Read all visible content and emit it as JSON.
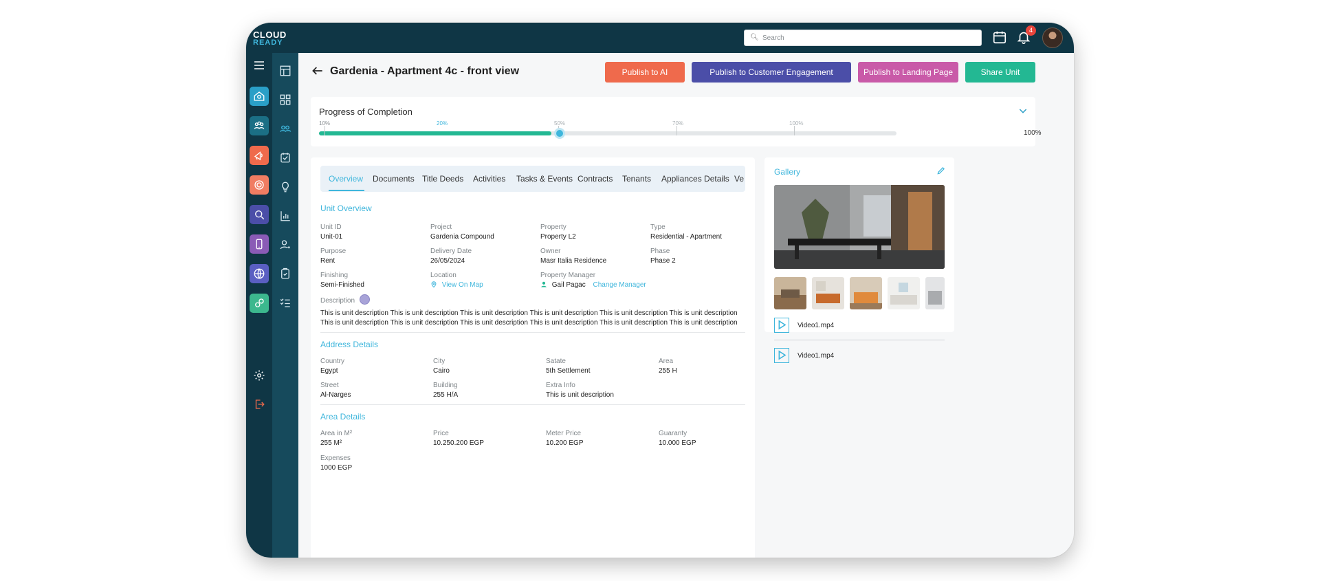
{
  "app": {
    "logo_line1": "CLOUD",
    "logo_line2": "READY"
  },
  "topbar": {
    "search_placeholder": "Search",
    "notification_count": "4"
  },
  "header": {
    "title": "Gardenia - Apartment 4c - front view",
    "buttons": [
      {
        "label": "Publish to AI",
        "color": "#ef6a4c"
      },
      {
        "label": "Publish to Customer Engagement",
        "color": "#4b4ea8"
      },
      {
        "label": "Publish to Landing Page",
        "color": "#c95aa8"
      },
      {
        "label": "Share Unit",
        "color": "#23b893"
      }
    ]
  },
  "progress": {
    "title": "Progress of Completion",
    "ticks": [
      "10%",
      "20%",
      "50%",
      "70%",
      "100%"
    ],
    "current": 20,
    "end_label": "100%"
  },
  "tabs": [
    "Overview",
    "Documents",
    "Title Deeds",
    "Activities",
    "Tasks & Events",
    "Contracts",
    "Tenants",
    "Appliances Details",
    "Ve"
  ],
  "unit_overview": {
    "title": "Unit Overview",
    "fields": [
      {
        "label": "Unit ID",
        "value": "Unit-01"
      },
      {
        "label": "Project",
        "value": "Gardenia Compound"
      },
      {
        "label": "Property",
        "value": "Property L2"
      },
      {
        "label": "Type",
        "value": "Residential - Apartment"
      },
      {
        "label": "Purpose",
        "value": "Rent"
      },
      {
        "label": "Delivery Date",
        "value": "26/05/2024"
      },
      {
        "label": "Owner",
        "value": "Masr Italia Residence"
      },
      {
        "label": "Phase",
        "value": "Phase 2"
      },
      {
        "label": "Finishing",
        "value": "Semi-Finished"
      }
    ],
    "location": {
      "label": "Location",
      "link": "View On Map"
    },
    "manager": {
      "label": "Property Manager",
      "name": "Gail Pagac",
      "link": "Change Manager"
    },
    "description_label": "Description",
    "description": "This is unit description This is unit description This is unit description This is unit description This is unit description This is unit description This is unit description This is unit description This is unit description This is unit description This is unit description This is unit description"
  },
  "address": {
    "title": "Address Details",
    "fields": [
      {
        "label": "Country",
        "value": "Egypt"
      },
      {
        "label": "City",
        "value": "Cairo"
      },
      {
        "label": "Satate",
        "value": "5th Settlement"
      },
      {
        "label": "Area",
        "value": "255 H"
      },
      {
        "label": "Street",
        "value": "Al-Narges"
      },
      {
        "label": "Building",
        "value": "255 H/A"
      },
      {
        "label": "Extra Info",
        "value": "This is unit description"
      }
    ]
  },
  "area": {
    "title": "Area Details",
    "fields": [
      {
        "label": "Area in M²",
        "value": "255 M²"
      },
      {
        "label": "Price",
        "value": "10.250.200 EGP"
      },
      {
        "label": "Meter Price",
        "value": "10.200 EGP"
      },
      {
        "label": "Guaranty",
        "value": "10.000 EGP"
      },
      {
        "label": "Expenses",
        "value": "1000 EGP"
      }
    ]
  },
  "gallery": {
    "title": "Gallery",
    "videos": [
      "Video1.mp4",
      "Video1.mp4"
    ]
  },
  "rail_icon_colors": [
    "#2a9fc7",
    "#1b6f85",
    "#ef6a4c",
    "#f07d62",
    "#4b4ea8",
    "#8a5bb6",
    "#5a5fc2",
    "#3cb88e"
  ]
}
